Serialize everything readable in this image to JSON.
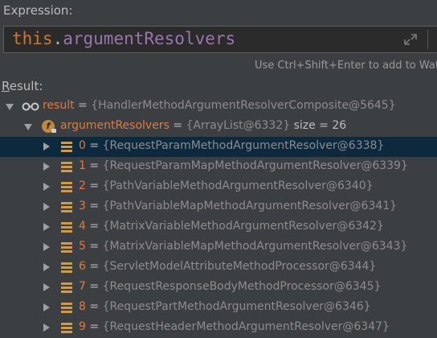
{
  "expression": {
    "label": "Expression:",
    "keyword": "this",
    "dot": ".",
    "member": "argumentResolvers",
    "hint": "Use Ctrl+Shift+Enter to add to Watc"
  },
  "result": {
    "label_first": "R",
    "label_rest": "esult:",
    "root": {
      "name": "result",
      "eq": " = ",
      "value": "{HandlerMethodArgumentResolverComposite@5645}"
    },
    "field": {
      "name": "argumentResolvers",
      "eq": " = ",
      "value": "{ArrayList@6332}",
      "size": " size = 26"
    },
    "items": [
      {
        "index": "0",
        "eq": " = ",
        "value": "{RequestParamMethodArgumentResolver@6338}"
      },
      {
        "index": "1",
        "eq": " = ",
        "value": "{RequestParamMapMethodArgumentResolver@6339}"
      },
      {
        "index": "2",
        "eq": " = ",
        "value": "{PathVariableMethodArgumentResolver@6340}"
      },
      {
        "index": "3",
        "eq": " = ",
        "value": "{PathVariableMapMethodArgumentResolver@6341}"
      },
      {
        "index": "4",
        "eq": " = ",
        "value": "{MatrixVariableMethodArgumentResolver@6342}"
      },
      {
        "index": "5",
        "eq": " = ",
        "value": "{MatrixVariableMapMethodArgumentResolver@6343}"
      },
      {
        "index": "6",
        "eq": " = ",
        "value": "{ServletModelAttributeMethodProcessor@6344}"
      },
      {
        "index": "7",
        "eq": " = ",
        "value": "{RequestResponseBodyMethodProcessor@6345}"
      },
      {
        "index": "8",
        "eq": " = ",
        "value": "{RequestPartMethodArgumentResolver@6346}"
      },
      {
        "index": "9",
        "eq": " = ",
        "value": "{RequestHeaderMethodArgumentResolver@6347}"
      }
    ]
  },
  "colors": {
    "background": "#3c3f41",
    "selection": "#0d293e",
    "variable_name": "#e07a3c",
    "keyword": "#cc7832",
    "member": "#9876aa"
  },
  "icons": {
    "watch": "glasses-icon",
    "field": "field-icon",
    "list_item": "stack-icon",
    "expand": "expand-icon"
  }
}
